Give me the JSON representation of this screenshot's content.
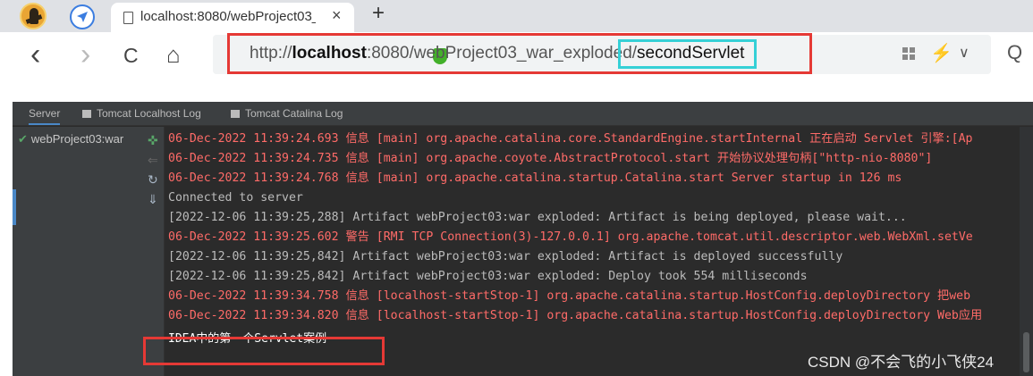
{
  "browser": {
    "tab_title": "localhost:8080/webProject03_",
    "tab_close": "×",
    "new_tab": "+",
    "url_prefix": "http://",
    "url_host": "localhost",
    "url_path": ":8080/webProject03_war_exploded/",
    "url_highlight": "secondServlet",
    "back": "‹",
    "forward": "›",
    "reload": "C",
    "home": "⌂",
    "bolt": "⚡",
    "chevron": "∨",
    "search": "Q"
  },
  "ide": {
    "tabs": [
      {
        "label": "Server"
      },
      {
        "label": "Tomcat Localhost Log"
      },
      {
        "label": "Tomcat Catalina Log"
      }
    ],
    "tree_item": "webProject03:war",
    "console_lines": [
      {
        "text": "06-Dec-2022 11:39:24.693 信息 [main] org.apache.catalina.core.StandardEngine.startInternal 正在启动 Servlet 引擎:[Ap",
        "color": "red"
      },
      {
        "text": "06-Dec-2022 11:39:24.735 信息 [main] org.apache.coyote.AbstractProtocol.start 开始协议处理句柄[\"http-nio-8080\"]",
        "color": "red"
      },
      {
        "text": "06-Dec-2022 11:39:24.768 信息 [main] org.apache.catalina.startup.Catalina.start Server startup in 126 ms",
        "color": "red"
      },
      {
        "text": "Connected to server",
        "color": "grey"
      },
      {
        "text": "[2022-12-06 11:39:25,288] Artifact webProject03:war exploded: Artifact is being deployed, please wait...",
        "color": "grey"
      },
      {
        "text": "06-Dec-2022 11:39:25.602 警告 [RMI TCP Connection(3)-127.0.0.1] org.apache.tomcat.util.descriptor.web.WebXml.setVe",
        "color": "red"
      },
      {
        "text": "[2022-12-06 11:39:25,842] Artifact webProject03:war exploded: Artifact is deployed successfully",
        "color": "grey"
      },
      {
        "text": "[2022-12-06 11:39:25,842] Artifact webProject03:war exploded: Deploy took 554 milliseconds",
        "color": "grey"
      },
      {
        "text": "06-Dec-2022 11:39:34.758 信息 [localhost-startStop-1] org.apache.catalina.startup.HostConfig.deployDirectory 把web",
        "color": "red"
      },
      {
        "text": "06-Dec-2022 11:39:34.820 信息 [localhost-startStop-1] org.apache.catalina.startup.HostConfig.deployDirectory Web应用",
        "color": "red"
      },
      {
        "text": "IDEA中的第一个Servlet案例",
        "color": "white"
      }
    ]
  },
  "watermark": "CSDN @不会飞的小飞侠24"
}
